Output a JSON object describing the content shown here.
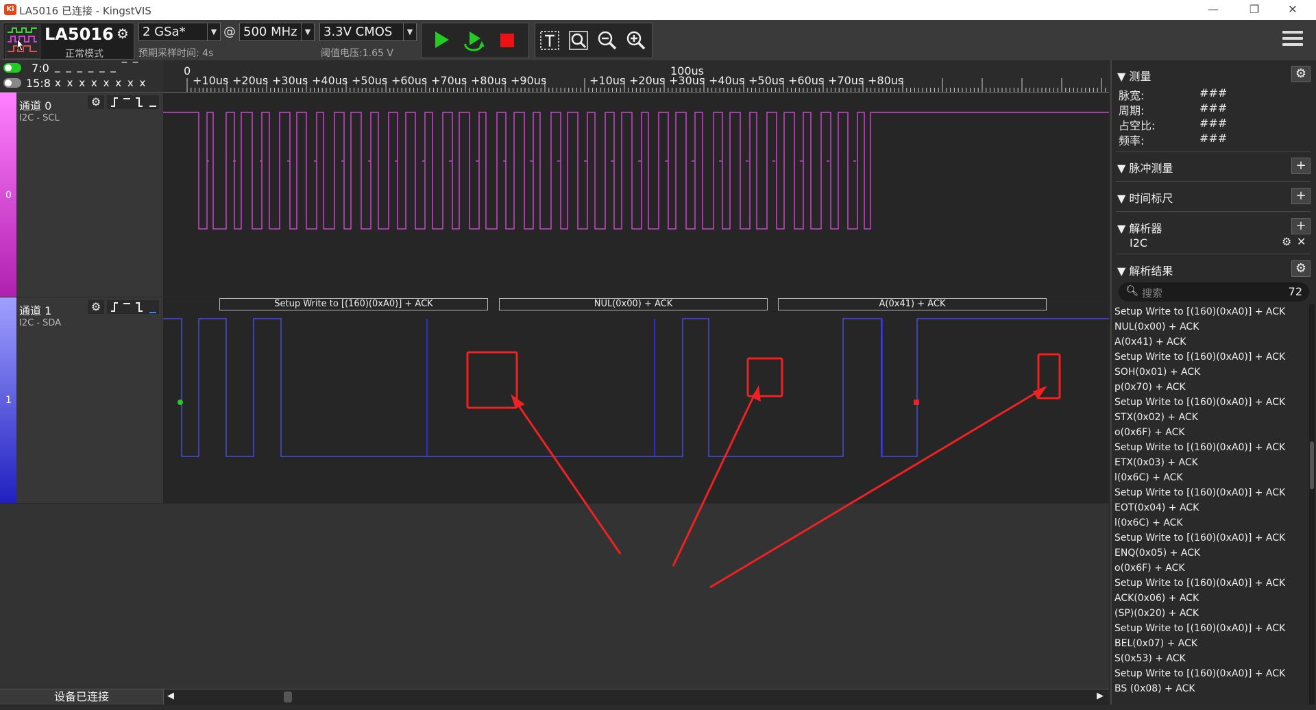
{
  "window": {
    "title": "LA5016 已连接 - KingstVIS",
    "min": "—",
    "restore": "❐",
    "close": "✕"
  },
  "device": {
    "name": "LA5016",
    "mode": "正常模式"
  },
  "toolbar": {
    "sample_rate": "2 GSa*",
    "at": "@",
    "sample_freq": "500 MHz",
    "voltage": "3.3V CMOS",
    "expected_time": "预期采样时间: 4s",
    "threshold": "阈值电压:1.65 V"
  },
  "channel_groups": {
    "group1_label": "7:0",
    "group1_marks": "_ _ _ _ _ _ ‾ ‾",
    "group2_label": "15:8",
    "group2_marks": "x x x x x x x x"
  },
  "ruler": {
    "start": "0",
    "mid": "100us",
    "ticks": [
      "+10us",
      "+20us",
      "+30us",
      "+40us",
      "+50us",
      "+60us",
      "+70us",
      "+80us",
      "+90us",
      "+10us",
      "+20us",
      "+30us",
      "+40us",
      "+50us",
      "+60us",
      "+70us",
      "+80us"
    ]
  },
  "channels": [
    {
      "name": "通道 0",
      "sub": "I2C - SCL",
      "num": "0",
      "color": "#d040d0"
    },
    {
      "name": "通道 1",
      "sub": "I2C - SDA",
      "num": "1",
      "color": "#4040e0"
    }
  ],
  "decode_labels": [
    "Setup Write to [(160)(0xA0)] + ACK",
    "NUL(0x00) + ACK",
    "A(0x41) + ACK"
  ],
  "status": {
    "device": "设备已连接",
    "left": "◀",
    "right": "▶"
  },
  "panel": {
    "measure": {
      "title": "测量",
      "rows": [
        {
          "label": "脉宽:",
          "value": "###"
        },
        {
          "label": "周期:",
          "value": "###"
        },
        {
          "label": "占空比:",
          "value": "###"
        },
        {
          "label": "频率:",
          "value": "###"
        }
      ]
    },
    "pulse": "脉冲测量",
    "timescale": "时间标尺",
    "analyzer": "解析器",
    "analyzer_item": "I2C",
    "results_title": "解析结果",
    "search_placeholder": "搜索",
    "count": "72",
    "results": [
      "Setup Write to [(160)(0xA0)] + ACK",
      "NUL(0x00) + ACK",
      "A(0x41) + ACK",
      "Setup Write to [(160)(0xA0)] + ACK",
      "SOH(0x01) + ACK",
      "p(0x70) + ACK",
      "Setup Write to [(160)(0xA0)] + ACK",
      "STX(0x02) + ACK",
      "o(0x6F) + ACK",
      "Setup Write to [(160)(0xA0)] + ACK",
      "ETX(0x03) + ACK",
      "l(0x6C) + ACK",
      "Setup Write to [(160)(0xA0)] + ACK",
      "EOT(0x04) + ACK",
      "l(0x6C) + ACK",
      "Setup Write to [(160)(0xA0)] + ACK",
      "ENQ(0x05) + ACK",
      "o(0x6F) + ACK",
      "Setup Write to [(160)(0xA0)] + ACK",
      "ACK(0x06) + ACK",
      "(SP)(0x20) + ACK",
      "Setup Write to [(160)(0xA0)] + ACK",
      "BEL(0x07) + ACK",
      "S(0x53) + ACK",
      "Setup Write to [(160)(0xA0)] + ACK",
      "BS (0x08) + ACK"
    ]
  }
}
